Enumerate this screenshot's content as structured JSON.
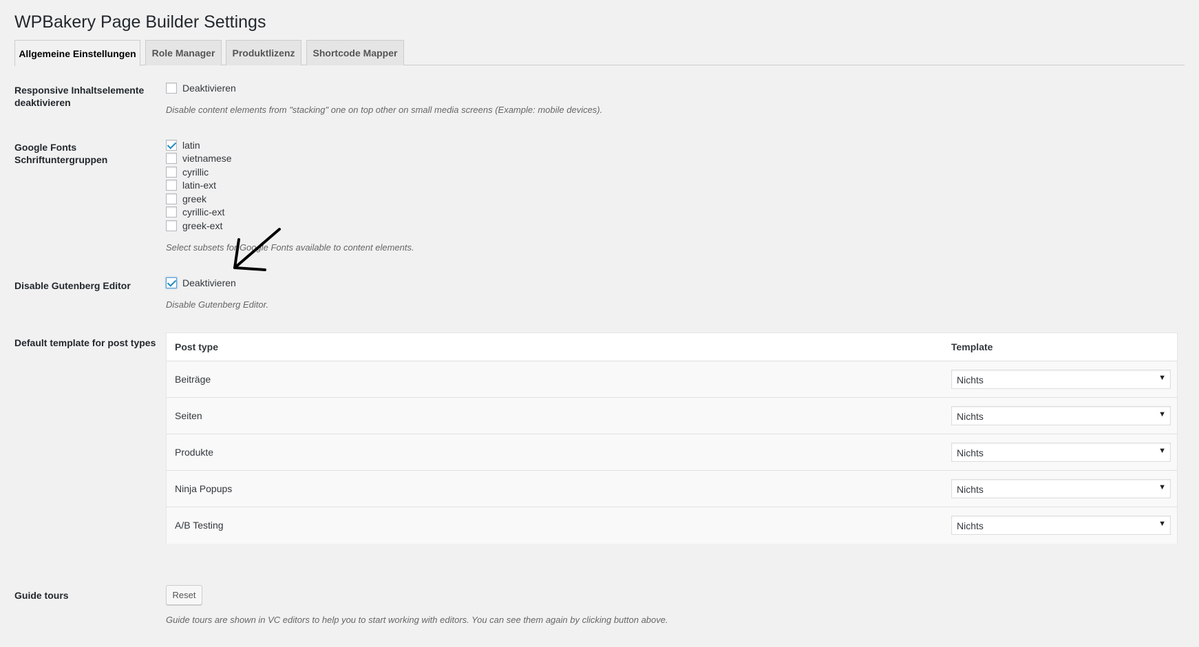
{
  "page_title": "WPBakery Page Builder Settings",
  "tabs": [
    {
      "label": "Allgemeine Einstellungen",
      "active": true
    },
    {
      "label": "Role Manager",
      "active": false
    },
    {
      "label": "Produktlizenz",
      "active": false
    },
    {
      "label": "Shortcode Mapper",
      "active": false
    }
  ],
  "responsive": {
    "label": "Responsive Inhaltselemente deaktivieren",
    "checkbox_label": "Deaktivieren",
    "checked": false,
    "description": "Disable content elements from \"stacking\" one on top other on small media screens (Example: mobile devices)."
  },
  "google_fonts": {
    "label": "Google Fonts Schriftuntergruppen",
    "subsets": [
      {
        "label": "latin",
        "checked": true
      },
      {
        "label": "vietnamese",
        "checked": false
      },
      {
        "label": "cyrillic",
        "checked": false
      },
      {
        "label": "latin-ext",
        "checked": false
      },
      {
        "label": "greek",
        "checked": false
      },
      {
        "label": "cyrillic-ext",
        "checked": false
      },
      {
        "label": "greek-ext",
        "checked": false
      }
    ],
    "description": "Select subsets for Google Fonts available to content elements."
  },
  "gutenberg": {
    "label": "Disable Gutenberg Editor",
    "checkbox_label": "Deaktivieren",
    "checked": true,
    "description": "Disable Gutenberg Editor."
  },
  "default_templates": {
    "label": "Default template for post types",
    "headers": {
      "post_type": "Post type",
      "template": "Template"
    },
    "rows": [
      {
        "post_type": "Beiträge",
        "template": "Nichts"
      },
      {
        "post_type": "Seiten",
        "template": "Nichts"
      },
      {
        "post_type": "Produkte",
        "template": "Nichts"
      },
      {
        "post_type": "Ninja Popups",
        "template": "Nichts"
      },
      {
        "post_type": "A/B Testing",
        "template": "Nichts"
      }
    ]
  },
  "guide_tours": {
    "label": "Guide tours",
    "button_label": "Reset",
    "description": "Guide tours are shown in VC editors to help you to start working with editors. You can see them again by clicking button above."
  },
  "colors": {
    "accent": "#1e8cbe",
    "background": "#f1f1f1"
  },
  "icons": {
    "select_arrow": "▼"
  }
}
